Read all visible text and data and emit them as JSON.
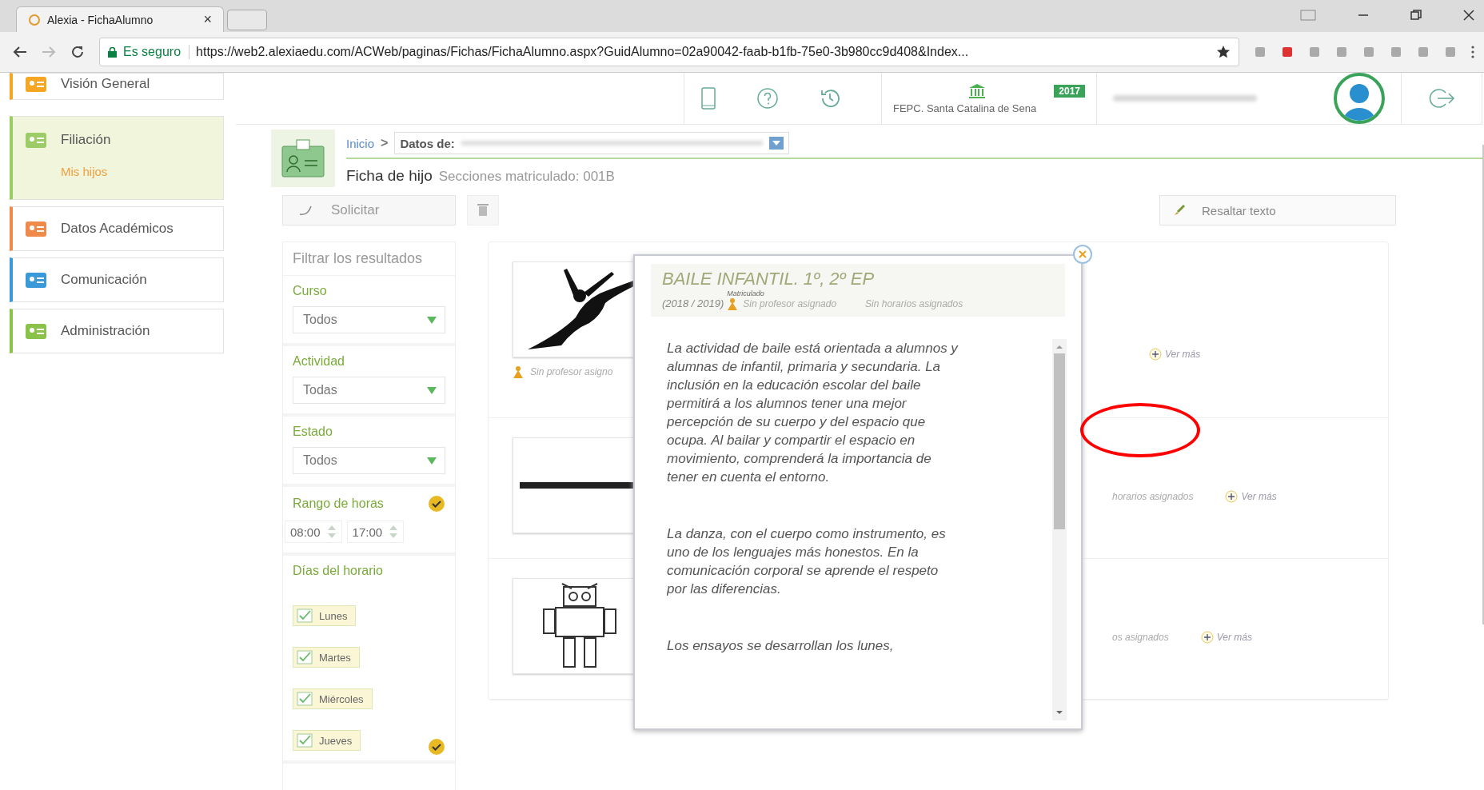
{
  "browser": {
    "tab_title": "Alexia - FichaAlumno",
    "tab_close": "×",
    "security": "Es seguro",
    "url": "https://web2.alexiaedu.com/ACWeb/paginas/Fichas/FichaAlumno.aspx?GuidAlumno=02a90042-faab-b1fb-75e0-3b980cc9d408&Index..."
  },
  "sidebar": {
    "items": [
      {
        "label": "Visión General",
        "selected": false,
        "color": "#f5a623"
      },
      {
        "label": "Filiación",
        "selected": true,
        "color": "#9ccc65",
        "children": [
          {
            "label": "Mis hijos"
          }
        ]
      },
      {
        "label": "Datos Académicos",
        "selected": false,
        "color": "#f08a4b"
      },
      {
        "label": "Comunicación",
        "selected": false,
        "color": "#3a9ad9"
      },
      {
        "label": "Administración",
        "selected": false,
        "color": "#8bc34a"
      }
    ]
  },
  "header": {
    "year_badge": "2017",
    "school": "FEPC. Santa Catalina de Sena"
  },
  "breadcrumb": {
    "home": "Inicio",
    "separator": ">",
    "field_label": "Datos de:"
  },
  "page_title": "Ficha de hijo",
  "page_subtitle": "Secciones matriculado: 001B",
  "toolbar": {
    "request_button": "Solicitar",
    "highlight_button": "Resaltar texto"
  },
  "filters": {
    "title": "Filtrar los resultados",
    "groups": [
      {
        "kind": "select",
        "label": "Curso",
        "value": "Todos",
        "active": false
      },
      {
        "kind": "select",
        "label": "Actividad",
        "value": "Todas",
        "active": false
      },
      {
        "kind": "select",
        "label": "Estado",
        "value": "Todos",
        "active": false
      },
      {
        "kind": "time_range",
        "label": "Rango de horas",
        "from": "08:00",
        "to": "17:00",
        "active": true
      },
      {
        "kind": "days",
        "label": "Días del horario",
        "active": true,
        "days": [
          {
            "label": "Lunes",
            "checked": true
          },
          {
            "label": "Martes",
            "checked": true
          },
          {
            "label": "Miércoles",
            "checked": true
          },
          {
            "label": "Jueves",
            "checked": true
          }
        ]
      }
    ]
  },
  "activities": [
    {
      "kind": "dancer",
      "teacher": "Sin profesor asigno",
      "more": "Ver más"
    },
    {
      "kind": "logo",
      "schedule": "horarios asignados",
      "more": "Ver más"
    },
    {
      "kind": "robot",
      "schedule": "os asignados",
      "more": "Ver más"
    }
  ],
  "popup": {
    "title": "BAILE INFANTIL. 1º, 2º EP",
    "year": "(2018 / 2019)",
    "status": "Matriculado",
    "teacher": "Sin profesor asignado",
    "schedule": "Sin horarios asignados",
    "paragraphs": [
      " La actividad de baile está orientada a alumnos y alumnas de infantil, primaria y secundaria. La inclusión en la educación  escolar del baile permitirá a los alumnos tener una mejor percepción de su cuerpo y del espacio que ocupa. Al bailar y compartir el espacio en movimiento, comprenderá la importancia de tener en cuenta el entorno.",
      "La danza, con el cuerpo como instrumento, es uno de los lenguajes más honestos.  En la comunicación corporal se aprende el respeto por las diferencias.",
      "Los ensayos se desarrollan los lunes,"
    ]
  }
}
